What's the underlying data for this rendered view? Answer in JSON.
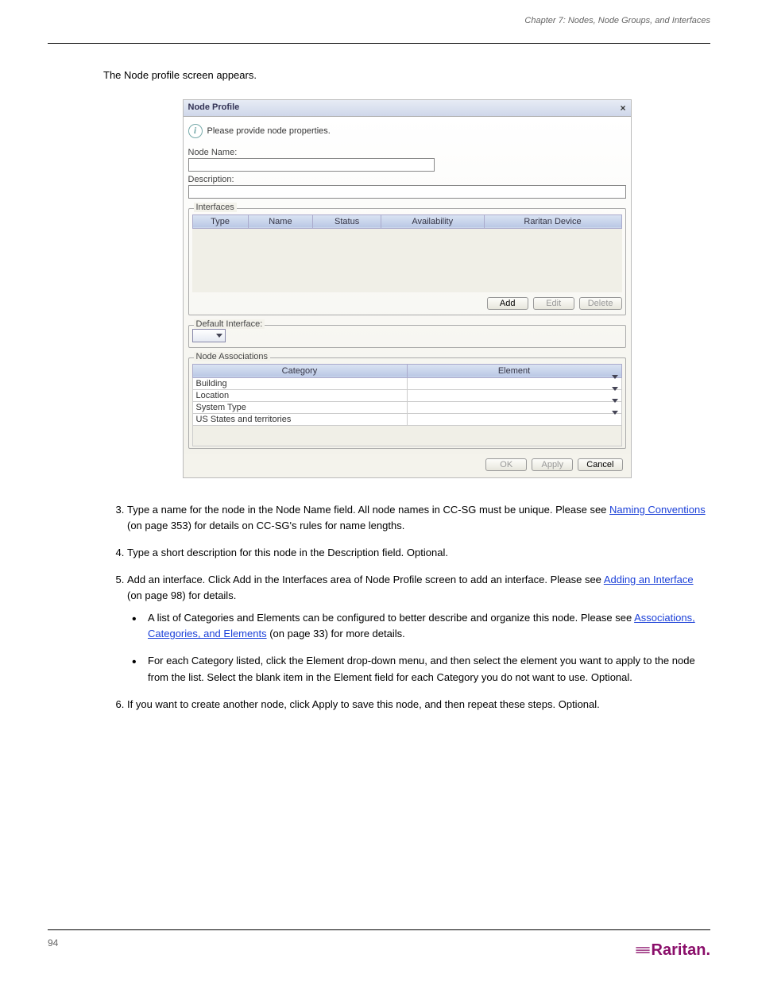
{
  "header": {
    "chapter": "Chapter 7: Nodes, Node Groups, and Interfaces"
  },
  "intro": "The Node profile screen appears.",
  "dialog": {
    "title": "Node Profile",
    "info": "Please provide node properties.",
    "nodeNameLabel": "Node Name:",
    "descriptionLabel": "Description:",
    "interfaces": {
      "legend": "Interfaces",
      "cols": [
        "Type",
        "Name",
        "Status",
        "Availability",
        "Raritan Device"
      ],
      "addBtn": "Add",
      "editBtn": "Edit",
      "deleteBtn": "Delete"
    },
    "defaultIf": {
      "legend": "Default Interface:"
    },
    "assoc": {
      "legend": "Node Associations",
      "cols": [
        "Category",
        "Element"
      ],
      "rows": [
        "Building",
        "Location",
        "System Type",
        "US States and territories"
      ]
    },
    "okBtn": "OK",
    "applyBtn": "Apply",
    "cancelBtn": "Cancel"
  },
  "steps": {
    "s3a": "Type a name for the node in the Node Name field. All node names in CC-SG must be unique. Please see ",
    "s3link": "Naming Conventions",
    "s3b": " (on page 353) for details on CC-SG's rules for name lengths.",
    "s4": "Type a short description for this node in the Description field. Optional.",
    "s5a": "Add an interface. Click Add in the Interfaces area of Node Profile screen to add an interface. Please see ",
    "s5link": "Adding an Interface",
    "s5b": " (on page 98) for details.",
    "s5bullet1": "A list of Categories and Elements can be configured to better describe and organize this node. Please see ",
    "s5bullet1link": "Associations, Categories, and Elements",
    "s5bullet1b": " (on page 33) for more details.",
    "s5bullet2": "For each Category listed, click the Element drop-down menu, and then select the element you want to apply to the node from the list. Select the blank item in the Element field for each Category you do not want to use. Optional.",
    "s6": "If you want to create another node, click Apply to save this node, and then repeat these steps. Optional."
  },
  "footer": {
    "page": "94",
    "logo": "Raritan."
  }
}
